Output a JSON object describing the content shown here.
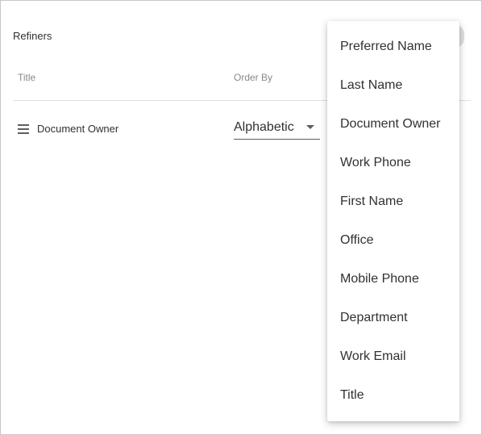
{
  "panel": {
    "title": "Refiners"
  },
  "columns": {
    "title_header": "Title",
    "order_header": "Order By"
  },
  "row": {
    "title": "Document Owner",
    "order_value": "Alphabetic"
  },
  "menu": {
    "items": [
      "Preferred Name",
      "Last Name",
      "Document Owner",
      "Work Phone",
      "First Name",
      "Office",
      "Mobile Phone",
      "Department",
      "Work Email",
      "Title"
    ]
  },
  "icons": {
    "drag": "drag-handle-icon",
    "caret": "chevron-down-icon"
  }
}
